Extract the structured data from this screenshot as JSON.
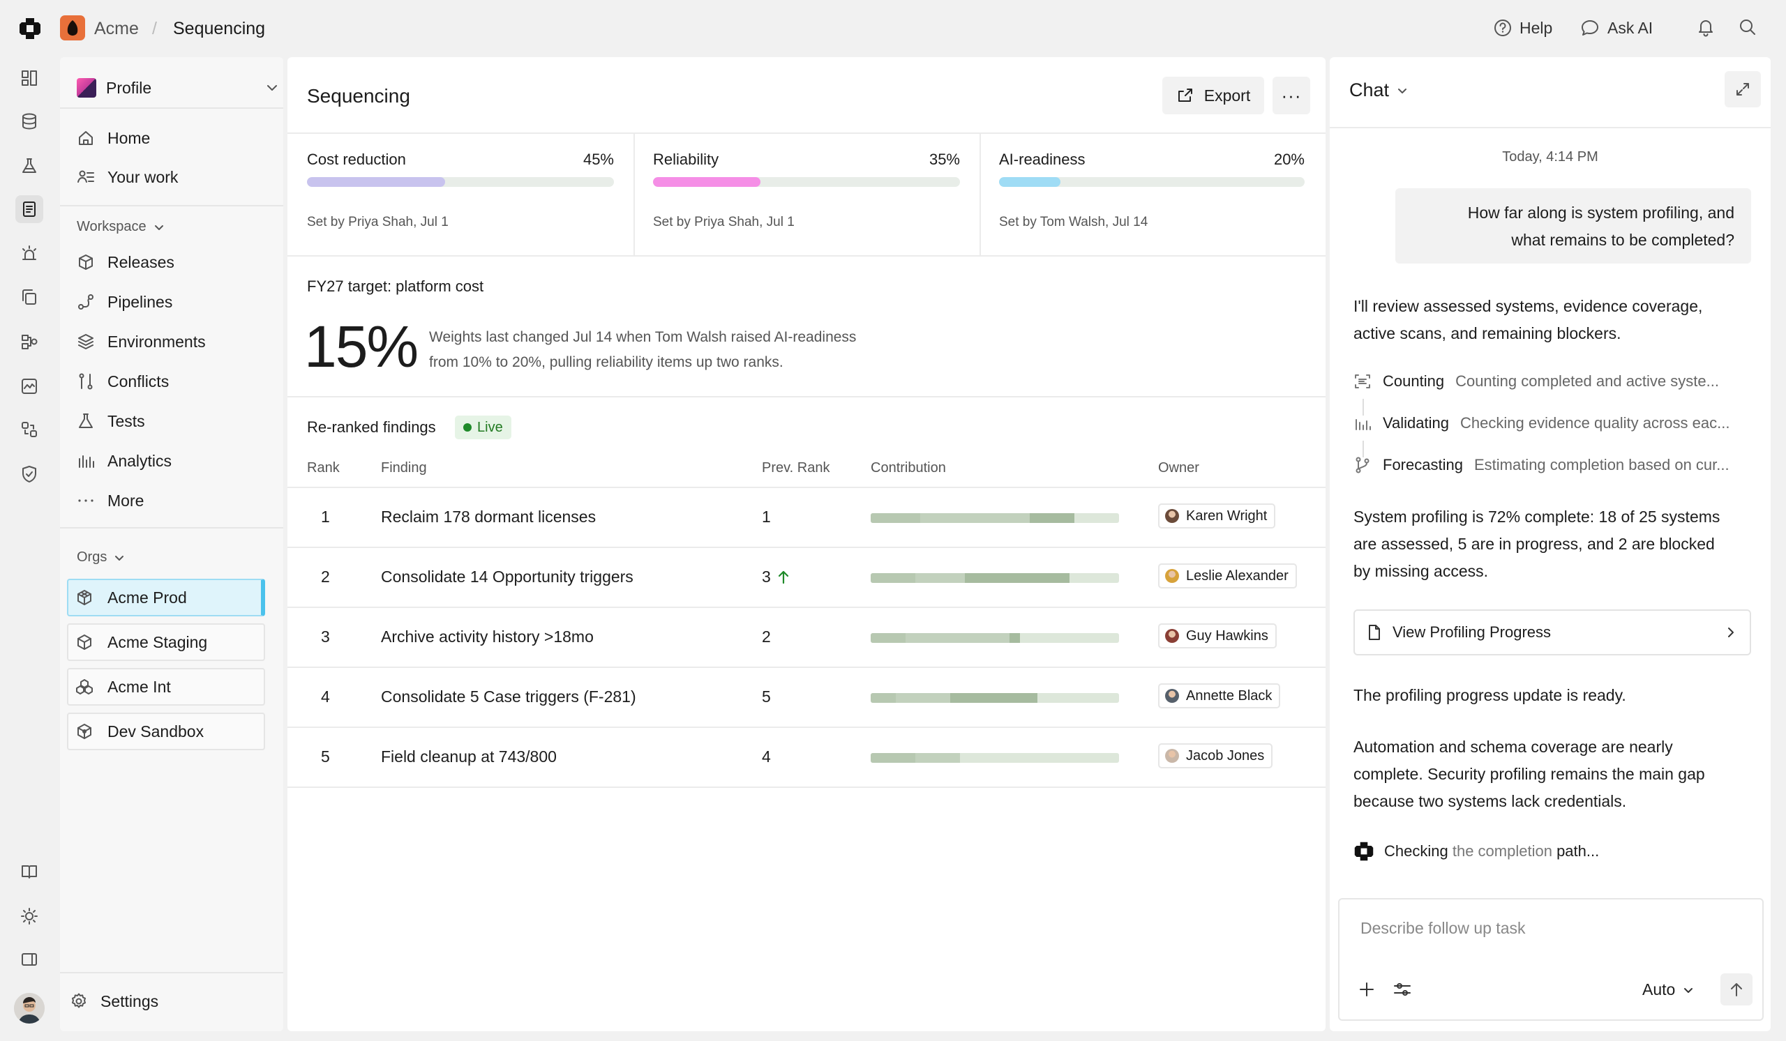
{
  "topbar": {
    "org": "Acme",
    "separator": "/",
    "page": "Sequencing",
    "help_label": "Help",
    "ask_ai_label": "Ask AI"
  },
  "sidebar": {
    "profile_label": "Profile",
    "nav": [
      {
        "label": "Home",
        "icon": "home-icon"
      },
      {
        "label": "Your work",
        "icon": "your-work-icon"
      }
    ],
    "workspace_label": "Workspace",
    "workspace_items": [
      {
        "label": "Releases",
        "icon": "box-icon"
      },
      {
        "label": "Pipelines",
        "icon": "pipeline-icon"
      },
      {
        "label": "Environments",
        "icon": "layers-icon"
      },
      {
        "label": "Conflicts",
        "icon": "git-compare-icon"
      },
      {
        "label": "Tests",
        "icon": "flask-icon"
      },
      {
        "label": "Analytics",
        "icon": "bar-chart-icon"
      },
      {
        "label": "More",
        "icon": "ellipsis-icon"
      }
    ],
    "orgs_label": "Orgs",
    "orgs": [
      {
        "label": "Acme Prod",
        "active": true
      },
      {
        "label": "Acme Staging",
        "active": false
      },
      {
        "label": "Acme Int",
        "active": false
      },
      {
        "label": "Dev Sandbox",
        "active": false
      }
    ],
    "settings_label": "Settings"
  },
  "main": {
    "title": "Sequencing",
    "export_label": "Export",
    "more_label": "···",
    "metrics": [
      {
        "name": "Cost reduction",
        "percent_label": "45%",
        "fill_fraction": 0.45,
        "color": "#c8c3ee",
        "set_by": "Set by Priya Shah, Jul 1"
      },
      {
        "name": "Reliability",
        "percent_label": "35%",
        "fill_fraction": 0.35,
        "color": "#f58ee6",
        "set_by": "Set by Priya Shah, Jul 1"
      },
      {
        "name": "AI-readiness",
        "percent_label": "20%",
        "fill_fraction": 0.2,
        "color": "#9fdcf5",
        "set_by": "Set by Tom Walsh, Jul 14"
      }
    ],
    "target_label": "FY27 target: platform cost",
    "target_value": "15%",
    "target_note_line1": "Weights last changed Jul 14 when Tom Walsh raised AI-readiness",
    "target_note_line2": "from 10% to 20%, pulling reliability items up two ranks.",
    "findings_title": "Re-ranked findings",
    "live_label": "Live",
    "columns": [
      "Rank",
      "Finding",
      "Prev. Rank",
      "Contribution",
      "Owner"
    ],
    "rows": [
      {
        "rank": "1",
        "finding": "Reclaim 178 dormant licenses",
        "prev": "1",
        "up": false,
        "contrib": [
          0.2,
          0.44,
          0.18
        ],
        "owner": "Karen Wright",
        "avatar": "#6b4b3a"
      },
      {
        "rank": "2",
        "finding": "Consolidate 14 Opportunity triggers",
        "prev": "3",
        "up": true,
        "contrib": [
          0.18,
          0.2,
          0.42
        ],
        "owner": "Leslie Alexander",
        "avatar": "#d7a23b"
      },
      {
        "rank": "3",
        "finding": "Archive activity history >18mo",
        "prev": "2",
        "up": false,
        "contrib": [
          0.14,
          0.42,
          0.04
        ],
        "owner": "Guy Hawkins",
        "avatar": "#8a3f35"
      },
      {
        "rank": "4",
        "finding": "Consolidate 5 Case triggers (F-281)",
        "prev": "5",
        "up": false,
        "contrib": [
          0.1,
          0.22,
          0.35
        ],
        "owner": "Annette Black",
        "avatar": "#56606b"
      },
      {
        "rank": "5",
        "finding": "Field cleanup at 743/800",
        "prev": "4",
        "up": false,
        "contrib": [
          0.18,
          0.18,
          0.0
        ],
        "owner": "Jacob Jones",
        "avatar": "#c9b7a8"
      }
    ]
  },
  "chat": {
    "title": "Chat",
    "timestamp": "Today, 4:14 PM",
    "user_msg_line1": "How far along is system profiling, and",
    "user_msg_line2": "what remains to be completed?",
    "ai_intro_line1": "I'll review assessed systems, evidence coverage,",
    "ai_intro_line2": "active scans, and remaining blockers.",
    "steps": [
      {
        "label": "Counting",
        "desc": "Counting completed and active syste...",
        "icon": "scan-icon"
      },
      {
        "label": "Validating",
        "desc": "Checking evidence quality across eac...",
        "icon": "bars-icon"
      },
      {
        "label": "Forecasting",
        "desc": "Estimating completion based on cur...",
        "icon": "branch-icon"
      }
    ],
    "summary_line1": "System profiling is 72% complete: 18 of 25 systems",
    "summary_line2": "are assessed, 5 are in progress, and 2 are blocked",
    "summary_line3": "by missing access.",
    "link_label": "View Profiling Progress",
    "ready_text": "The profiling progress update is ready.",
    "detail_line1": "Automation and schema coverage are nearly",
    "detail_line2": "complete. Security profiling remains the main gap",
    "detail_line3": "because two systems lack credentials.",
    "checking_dark": "Checking",
    "checking_light": "the completion",
    "checking_end": "path...",
    "input_placeholder": "Describe follow up task",
    "mode_label": "Auto"
  }
}
